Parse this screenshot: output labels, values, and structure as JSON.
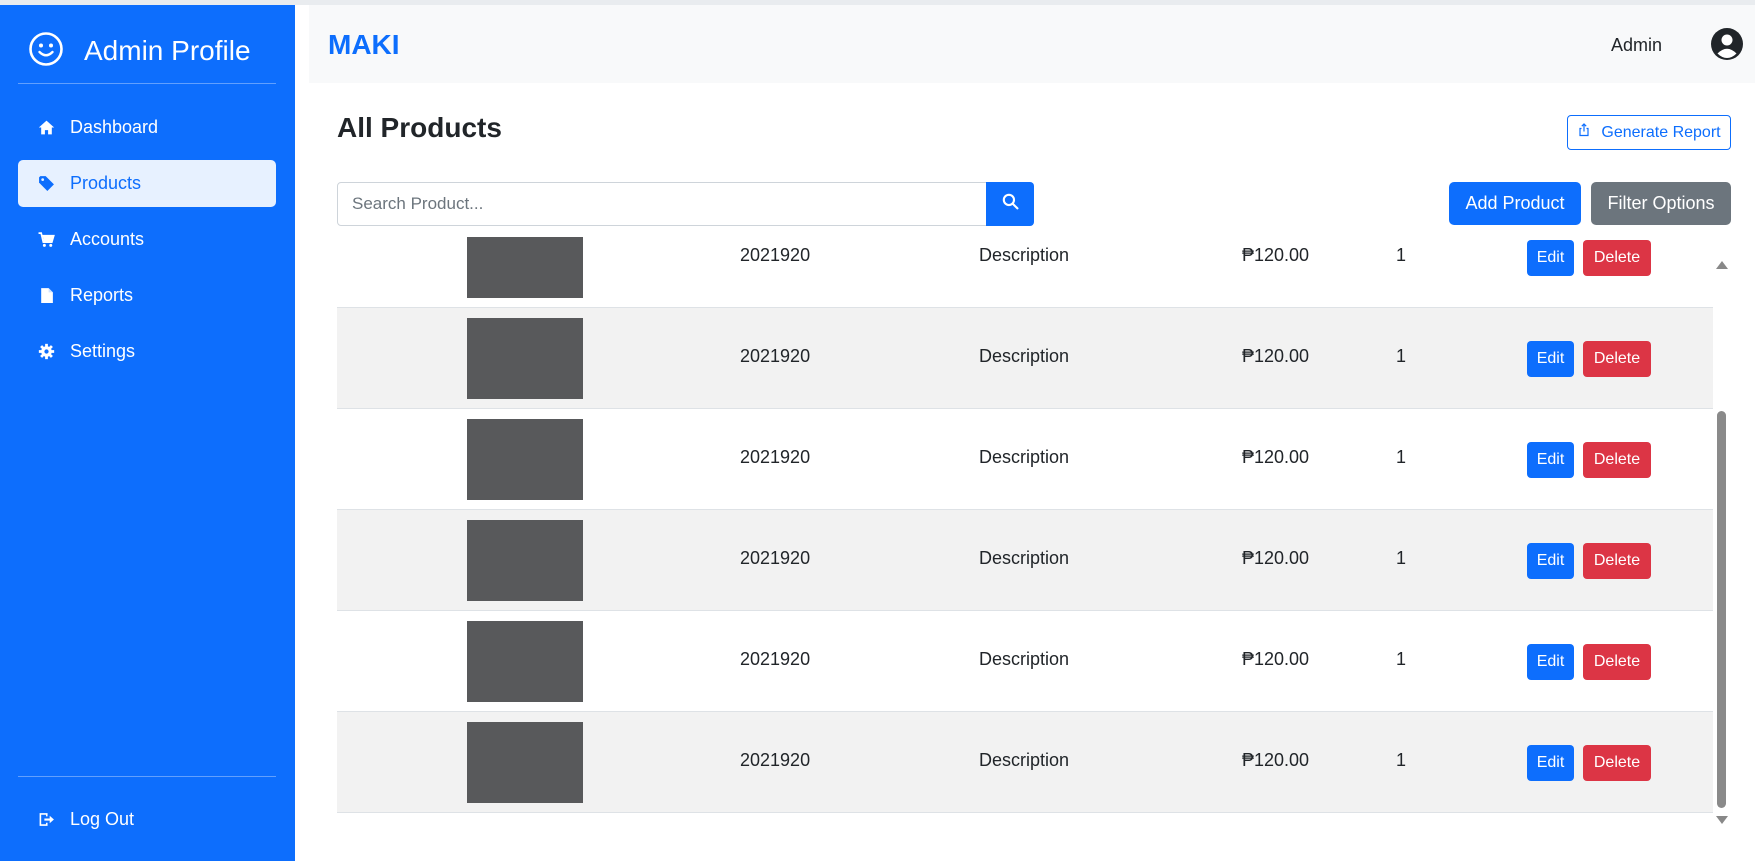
{
  "sidebar": {
    "brand_icon": "smiley-icon",
    "brand_label": "Admin Profile",
    "items": [
      {
        "icon": "home-icon",
        "label": "Dashboard"
      },
      {
        "icon": "tag-icon",
        "label": "Products",
        "active": true
      },
      {
        "icon": "cart-icon",
        "label": "Accounts"
      },
      {
        "icon": "file-icon",
        "label": "Reports"
      },
      {
        "icon": "gear-icon",
        "label": "Settings"
      }
    ],
    "logout": {
      "icon": "logout-icon",
      "label": "Log Out"
    }
  },
  "header": {
    "logo": "MAKI",
    "user_name": "Admin",
    "user_icon": "user-circle-icon"
  },
  "main": {
    "title": "All Products",
    "report_button": "Generate Report",
    "search_placeholder": "Search Product...",
    "add_button": "Add Product",
    "filter_button": "Filter Options",
    "rows": [
      {
        "code": "2021920",
        "description": "Description",
        "price": "₱120.00",
        "qty": "1",
        "edit": "Edit",
        "delete": "Delete"
      },
      {
        "code": "2021920",
        "description": "Description",
        "price": "₱120.00",
        "qty": "1",
        "edit": "Edit",
        "delete": "Delete"
      },
      {
        "code": "2021920",
        "description": "Description",
        "price": "₱120.00",
        "qty": "1",
        "edit": "Edit",
        "delete": "Delete"
      },
      {
        "code": "2021920",
        "description": "Description",
        "price": "₱120.00",
        "qty": "1",
        "edit": "Edit",
        "delete": "Delete"
      },
      {
        "code": "2021920",
        "description": "Description",
        "price": "₱120.00",
        "qty": "1",
        "edit": "Edit",
        "delete": "Delete"
      },
      {
        "code": "2021920",
        "description": "Description",
        "price": "₱120.00",
        "qty": "1",
        "edit": "Edit",
        "delete": "Delete"
      }
    ]
  },
  "colors": {
    "primary": "#0d6efd",
    "danger": "#dc3545",
    "secondary": "#6c757d",
    "thumbnail": "#58595b"
  }
}
